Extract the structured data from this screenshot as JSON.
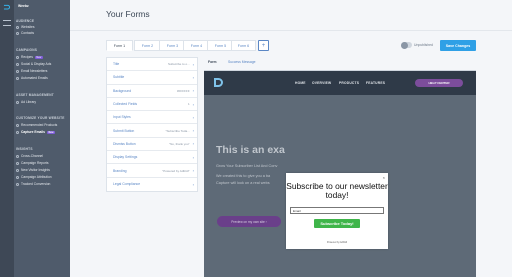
{
  "sidebar": {
    "user_name": "Weebz",
    "sections": [
      {
        "heading": "AUDIENCE",
        "items": [
          {
            "label": "Websites"
          },
          {
            "label": "Contacts"
          }
        ]
      },
      {
        "heading": "CAMPAIGNS",
        "items": [
          {
            "label": "Recipes",
            "badge": "New"
          },
          {
            "label": "Social & Display Ads"
          },
          {
            "label": "Email Newsletters"
          },
          {
            "label": "Automated Emails"
          }
        ]
      },
      {
        "heading": "ASSET MANAGEMENT",
        "items": [
          {
            "label": "Ad Library"
          }
        ]
      },
      {
        "heading": "CUSTOMIZE YOUR WEBSITE",
        "items": [
          {
            "label": "Recommended Products"
          },
          {
            "label": "Capture Emails",
            "badge": "New"
          }
        ]
      },
      {
        "heading": "INSIGHTS",
        "items": [
          {
            "label": "Cross-Channel"
          },
          {
            "label": "Campaign Reports"
          },
          {
            "label": "New Visitor Insights"
          },
          {
            "label": "Campaign Attribution"
          },
          {
            "label": "Tracked Conversion"
          }
        ]
      }
    ]
  },
  "header": {
    "title": "Your Forms"
  },
  "tabs": [
    "Form 1",
    "Form 2",
    "Form 3",
    "Form 4",
    "Form 5",
    "Form 6"
  ],
  "add_tab_label": "+",
  "publish": {
    "status_label": "Unpublished",
    "save_label": "Save Changes"
  },
  "settings": [
    {
      "label": "Title",
      "value": "Subscribe to o..."
    },
    {
      "label": "Subtitle",
      "value": ""
    },
    {
      "label": "Background",
      "value": "#FFFFFF"
    },
    {
      "label": "Collected Fields",
      "value": "1"
    },
    {
      "label": "Input Styles",
      "value": ""
    },
    {
      "label": "Submit Button",
      "value": "\"Subscribe Toda..."
    },
    {
      "label": "Dismiss Button",
      "value": "\"No, thank you\""
    },
    {
      "label": "Display Settings",
      "value": ""
    },
    {
      "label": "Branding",
      "value": "\"Powered by AdRoll\""
    },
    {
      "label": "Legal Compliance",
      "value": ""
    }
  ],
  "preview_tabs": {
    "form": "Form",
    "success": "Success Message"
  },
  "preview": {
    "nav": [
      "HOME",
      "OVERVIEW",
      "PRODUCTS",
      "FEATURES"
    ],
    "help_button": "HELP CENTER",
    "hero_title": "This is an exa",
    "hero_sub1": "Grow Your Subscriber List And Conv",
    "hero_sub2": "We created this to give you a ba",
    "hero_sub3": "Capture will look on a real webs",
    "hero_button": "Preview on my own site ›"
  },
  "popup": {
    "close": "×",
    "title": "Subscribe to our newsletter today!",
    "email_placeholder": "Email",
    "button": "Subscribe Today!",
    "powered": "Powered by AdRoll"
  }
}
